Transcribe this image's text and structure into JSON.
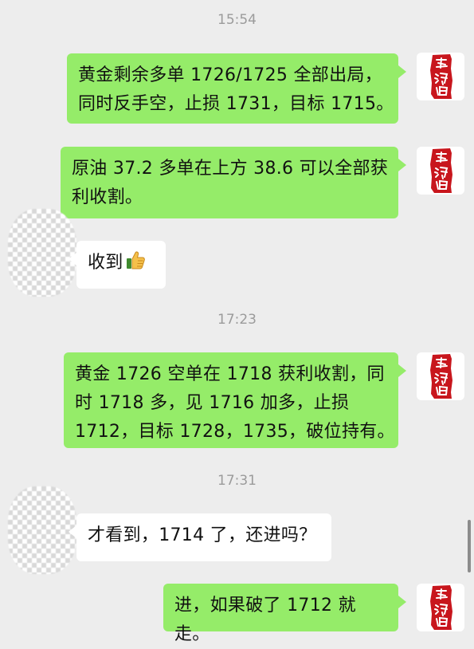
{
  "timestamps": [
    "15:54",
    "17:23",
    "17:31"
  ],
  "messages": [
    {
      "lines": [
        "黄金剩余多单 1726/1725 全部出局，",
        "同时反手空，止损 1731，目标 1715。"
      ]
    },
    {
      "lines": [
        "原油 37.2 多单在上方 38.6 可以全部获",
        "利收割。"
      ]
    },
    {
      "text": "收到",
      "emoji": "thumbs-up"
    },
    {
      "lines": [
        "黄金 1726 空单在 1718 获利收割，同",
        "时 1718 多，见 1716 加多，止损",
        "1712，目标 1728，1735，破位持有。"
      ]
    },
    {
      "text": "才看到，1714 了，还进吗？"
    },
    {
      "text": "进，如果破了 1712 就走。"
    }
  ],
  "colors": {
    "outgoing": "#95ec69",
    "incoming": "#ffffff",
    "background": "#ededed",
    "seal": "#c8161d"
  }
}
